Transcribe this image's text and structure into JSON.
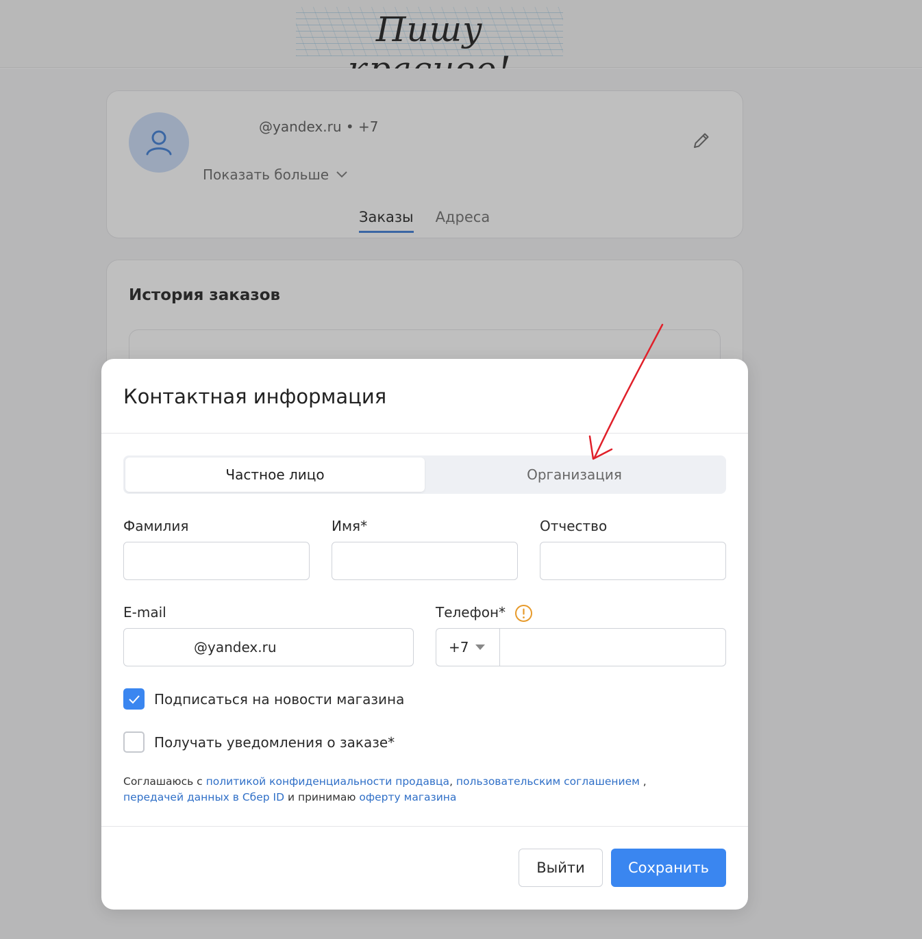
{
  "header": {
    "logo_text": "Пишу красиво!"
  },
  "profile": {
    "contacts": "@yandex.ru • +7",
    "show_more": "Показать больше",
    "tabs": [
      {
        "label": "Заказы",
        "active": true
      },
      {
        "label": "Адреса",
        "active": false
      }
    ]
  },
  "orders": {
    "title": "История заказов"
  },
  "modal": {
    "title": "Контактная информация",
    "segments": [
      {
        "label": "Частное лицо",
        "active": true
      },
      {
        "label": "Организация",
        "active": false
      }
    ],
    "fields": {
      "last_name_label": "Фамилия",
      "first_name_label": "Имя*",
      "middle_name_label": "Отчество",
      "email_label": "E-mail",
      "email_value": "@yandex.ru",
      "phone_label": "Телефон*",
      "phone_code": "+7"
    },
    "checkboxes": [
      {
        "label": "Подписаться на новости магазина",
        "checked": true
      },
      {
        "label": "Получать уведомления о заказе*",
        "checked": false
      }
    ],
    "legal": {
      "t1": "Соглашаюсь с ",
      "l1": "политикой конфиденциальности продавца",
      "t2": ", ",
      "l2": "пользовательским соглашением",
      "t3": " ,",
      "l3": "передачей данных в Сбер ID",
      "t4": " и принимаю ",
      "l4": "оферту магазина"
    },
    "buttons": {
      "exit": "Выйти",
      "save": "Сохранить"
    }
  },
  "colors": {
    "accent": "#3a86f0",
    "link": "#2f6fc7",
    "warning": "#e79a2b",
    "annotation_arrow": "#e0202a"
  }
}
